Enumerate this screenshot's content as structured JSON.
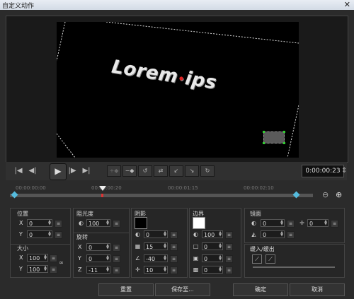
{
  "window": {
    "title": "自定义动作",
    "close_glyph": "✕"
  },
  "preview": {
    "text": "Lorem ips",
    "dot": "●"
  },
  "controls": {
    "start_glyph": "|◀",
    "prev_glyph": "◀|",
    "play_glyph": "▶",
    "next_glyph": "|▶",
    "end_glyph": "▶|",
    "timecode": "0:00:00:23",
    "timecode_arrows": "⇕"
  },
  "timeline": {
    "ticks": [
      "00:00:00:00",
      "00:00:00:20",
      "00:00:01:15",
      "00:00:02:10"
    ],
    "zoom_out": "⊖",
    "zoom_in": "⊕"
  },
  "position": {
    "label": "位置",
    "x_label": "X",
    "x": "0",
    "y_label": "Y",
    "y": "0"
  },
  "size": {
    "label": "大小",
    "x_label": "X",
    "x": "100",
    "y_label": "Y",
    "y": "100"
  },
  "opacity": {
    "label": "阻光度",
    "value": "100"
  },
  "rotation": {
    "label": "旋转",
    "x_label": "X",
    "x": "0",
    "y_label": "Y",
    "y": "0",
    "z_label": "Z",
    "z": "-11"
  },
  "shadow": {
    "label": "阴影",
    "color": "#000000",
    "opacity": "0",
    "blur": "15",
    "angle": "-40",
    "distance": "10"
  },
  "border": {
    "label": "边界",
    "color": "#ffffff",
    "opacity": "100",
    "width": "0",
    "v1": "0",
    "v2": "0"
  },
  "mirror": {
    "label": "镜面",
    "opacity": "0",
    "distance": "0",
    "offset": "0"
  },
  "ease": {
    "label": "缓入/缓出"
  },
  "buttons": {
    "reset": "重置",
    "save_as": "保存至...",
    "ok": "确定",
    "cancel": "取消"
  }
}
